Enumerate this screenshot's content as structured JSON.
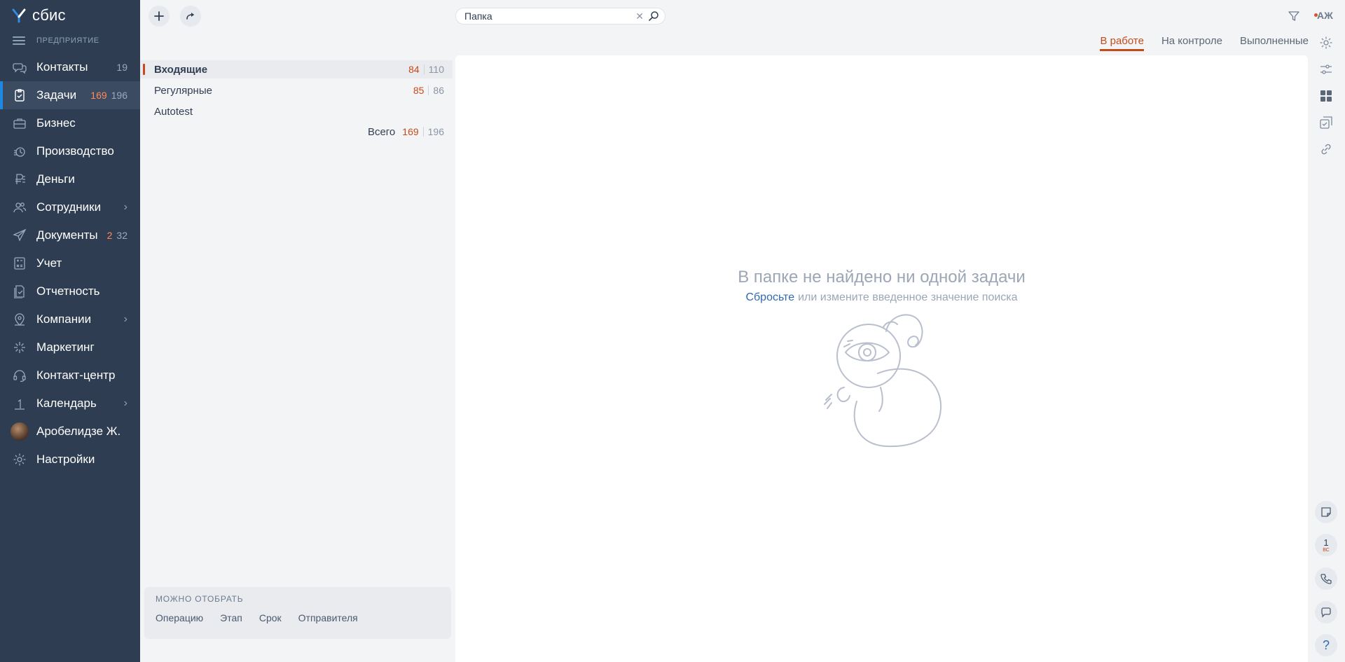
{
  "app": {
    "logo_text": "сбис",
    "org_label": "ПРЕДПРИЯТИЕ"
  },
  "nav": [
    {
      "label": "Контакты",
      "icon": "chat-bubbles-icon",
      "count_all": "19"
    },
    {
      "label": "Задачи",
      "icon": "task-clipboard-icon",
      "count_new": "169",
      "count_all": "196",
      "active": true
    },
    {
      "label": "Бизнес",
      "icon": "briefcase-icon"
    },
    {
      "label": "Производство",
      "icon": "factory-icon"
    },
    {
      "label": "Деньги",
      "icon": "ruble-icon"
    },
    {
      "label": "Сотрудники",
      "icon": "people-icon",
      "chevron": true
    },
    {
      "label": "Документы",
      "icon": "paper-plane-icon",
      "count_new": "2",
      "count_all": "32"
    },
    {
      "label": "Учет",
      "icon": "calculator-icon"
    },
    {
      "label": "Отчетность",
      "icon": "report-icon"
    },
    {
      "label": "Компании",
      "icon": "location-pin-icon",
      "chevron": true
    },
    {
      "label": "Маркетинг",
      "icon": "sparkle-icon"
    },
    {
      "label": "Контакт-центр",
      "icon": "headset-icon"
    },
    {
      "label": "Календарь",
      "icon": "calendar-icon",
      "chevron": true
    },
    {
      "label": "Аробелидзе Ж.",
      "icon": "avatar"
    },
    {
      "label": "Настройки",
      "icon": "gear-icon"
    }
  ],
  "search": {
    "value": "Папка"
  },
  "user": {
    "initials": "АЖ"
  },
  "tabs": [
    {
      "label": "В работе",
      "active": true
    },
    {
      "label": "На контроле"
    },
    {
      "label": "Выполненные"
    }
  ],
  "folders": [
    {
      "label": "Входящие",
      "count_new": "84",
      "count_all": "110",
      "active": true
    },
    {
      "label": "Регулярные",
      "count_new": "85",
      "count_all": "86"
    },
    {
      "label": "Autotest"
    }
  ],
  "total": {
    "label": "Всего",
    "count_new": "169",
    "count_all": "196"
  },
  "can_filter": {
    "title": "МОЖНО ОТОБРАТЬ",
    "links": [
      "Операцию",
      "Этап",
      "Срок",
      "Отправителя"
    ]
  },
  "empty_state": {
    "title": "В папке не найдено ни одной задачи",
    "reset_link": "Сбросьте",
    "rest": "или измените введенное значение поиска"
  },
  "calendar_widget": {
    "day": "1",
    "weekday": "ВС"
  },
  "help_label": "?",
  "colors": {
    "sidebar_bg": "#2e3d52",
    "accent": "#c74a1a",
    "active_marker": "#1e88e5",
    "link": "#2e6ab3"
  }
}
